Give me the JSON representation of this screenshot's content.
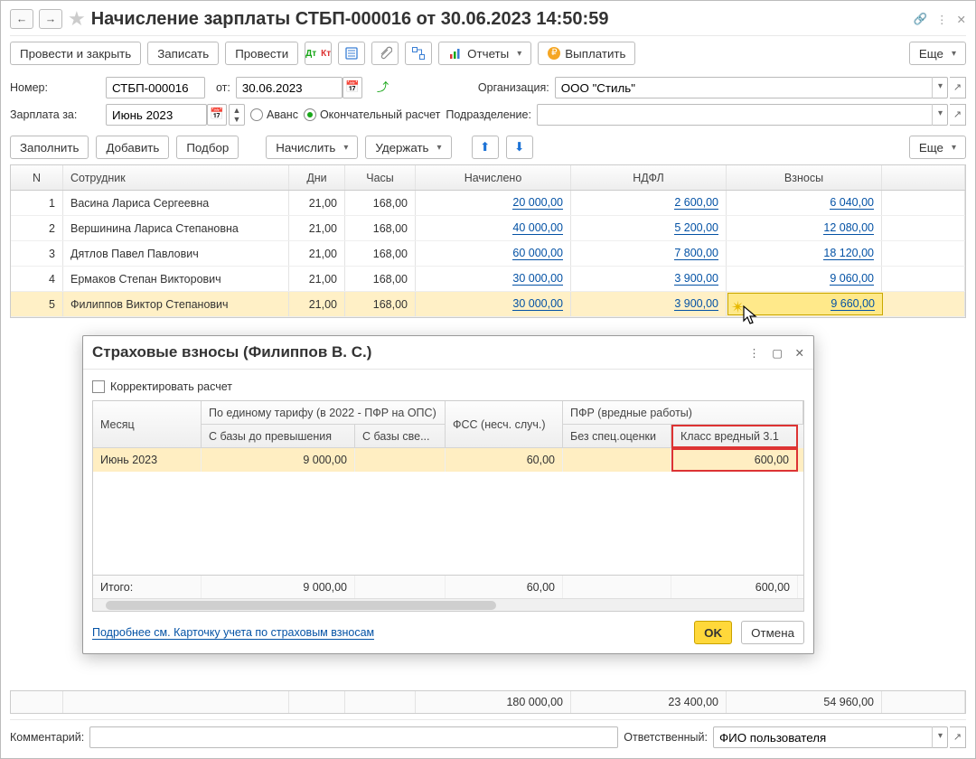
{
  "title": "Начисление зарплаты СТБП-000016 от 30.06.2023 14:50:59",
  "toolbar": {
    "post_close": "Провести и закрыть",
    "save": "Записать",
    "post": "Провести",
    "reports": "Отчеты",
    "pay": "Выплатить",
    "more": "Еще"
  },
  "fields": {
    "number_label": "Номер:",
    "number_value": "СТБП-000016",
    "from_label": "от:",
    "date_value": "30.06.2023",
    "org_label": "Организация:",
    "org_value": "ООО \"Стиль\"",
    "salary_for_label": "Зарплата за:",
    "salary_for_value": "Июнь 2023",
    "advance_label": "Аванс",
    "final_label": "Окончательный расчет",
    "dept_label": "Подразделение:",
    "dept_value": ""
  },
  "sub_toolbar": {
    "fill": "Заполнить",
    "add": "Добавить",
    "pick": "Подбор",
    "accrue": "Начислить",
    "withhold": "Удержать",
    "more": "Еще"
  },
  "columns": {
    "n": "N",
    "emp": "Сотрудник",
    "days": "Дни",
    "hours": "Часы",
    "accrued": "Начислено",
    "ndfl": "НДФЛ",
    "fees": "Взносы"
  },
  "rows": [
    {
      "n": "1",
      "emp": "Васина Лариса Сергеевна",
      "days": "21,00",
      "hours": "168,00",
      "accrued": "20 000,00",
      "ndfl": "2 600,00",
      "fees": "6 040,00"
    },
    {
      "n": "2",
      "emp": "Вершинина Лариса Степановна",
      "days": "21,00",
      "hours": "168,00",
      "accrued": "40 000,00",
      "ndfl": "5 200,00",
      "fees": "12 080,00"
    },
    {
      "n": "3",
      "emp": "Дятлов Павел Павлович",
      "days": "21,00",
      "hours": "168,00",
      "accrued": "60 000,00",
      "ndfl": "7 800,00",
      "fees": "18 120,00"
    },
    {
      "n": "4",
      "emp": "Ермаков Степан Викторович",
      "days": "21,00",
      "hours": "168,00",
      "accrued": "30 000,00",
      "ndfl": "3 900,00",
      "fees": "9 060,00"
    },
    {
      "n": "5",
      "emp": "Филиппов Виктор Степанович",
      "days": "21,00",
      "hours": "168,00",
      "accrued": "30 000,00",
      "ndfl": "3 900,00",
      "fees": "9 660,00"
    }
  ],
  "totals": {
    "accrued": "180 000,00",
    "ndfl": "23 400,00",
    "fees": "54 960,00"
  },
  "popup": {
    "title": "Страховые взносы (Филиппов В. С.)",
    "correct_label": "Корректировать расчет",
    "hdr_month": "Месяц",
    "hdr_uniform": "По единому тарифу (в 2022 - ПФР на ОПС)",
    "hdr_base1": "С базы до превышения",
    "hdr_base2": "С базы све...",
    "hdr_fss": "ФСС (несч. случ.)",
    "hdr_pfr": "ПФР (вредные работы)",
    "hdr_pfr_a": "Без спец.оценки",
    "hdr_pfr_b": "Класс вредный 3.1",
    "row_month": "Июнь 2023",
    "row_base1": "9 000,00",
    "row_fss": "60,00",
    "row_pfr2": "600,00",
    "total_label": "Итого:",
    "total_base1": "9 000,00",
    "total_fss": "60,00",
    "total_pfr2": "600,00",
    "link": "Подробнее см. Карточку учета по страховым взносам",
    "ok": "OK",
    "cancel": "Отмена"
  },
  "footer": {
    "comment_label": "Комментарий:",
    "comment_value": "",
    "resp_label": "Ответственный:",
    "resp_value": "ФИО пользователя"
  }
}
